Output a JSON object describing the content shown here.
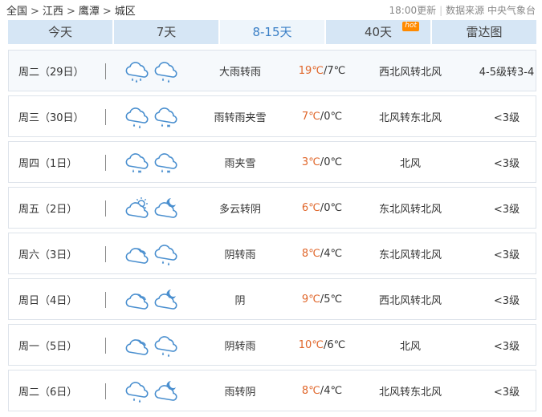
{
  "breadcrumb": [
    "全国",
    "江西",
    "鹰潭",
    "城区"
  ],
  "update_time": "18:00更新",
  "source": "数据来源 中央气象台",
  "tabs": [
    {
      "label": "今天",
      "active": false
    },
    {
      "label": "7天",
      "active": false
    },
    {
      "label": "8-15天",
      "active": true
    },
    {
      "label": "40天",
      "active": false,
      "badge": "hot"
    },
    {
      "label": "雷达图",
      "active": false
    }
  ],
  "colors": {
    "high_temp": "#e0662a",
    "active_tab_text": "#3a7fc6",
    "tab_bg": "#d6e6f5",
    "badge": "#ff8a00"
  },
  "days": [
    {
      "day": "周二（29日）",
      "icons": [
        "heavy-rain-icon",
        "rain-icon"
      ],
      "weather": "大雨转雨",
      "high": "19℃",
      "low": "7℃",
      "wind": "西北风转北风",
      "level": "4-5级转3-4"
    },
    {
      "day": "周三（30日）",
      "icons": [
        "rain-icon",
        "sleet-icon"
      ],
      "weather": "雨转雨夹雪",
      "high": "7℃",
      "low": "0℃",
      "wind": "北风转东北风",
      "level": "<3级"
    },
    {
      "day": "周四（1日）",
      "icons": [
        "sleet-icon",
        "sleet-icon"
      ],
      "weather": "雨夹雪",
      "high": "3℃",
      "low": "0℃",
      "wind": "北风",
      "level": "<3级"
    },
    {
      "day": "周五（2日）",
      "icons": [
        "partly-cloudy-day-icon",
        "partly-cloudy-night-icon"
      ],
      "weather": "多云转阴",
      "high": "6℃",
      "low": "0℃",
      "wind": "东北风转北风",
      "level": "<3级"
    },
    {
      "day": "周六（3日）",
      "icons": [
        "overcast-icon",
        "rain-icon"
      ],
      "weather": "阴转雨",
      "high": "8℃",
      "low": "4℃",
      "wind": "东北风转北风",
      "level": "<3级"
    },
    {
      "day": "周日（4日）",
      "icons": [
        "overcast-icon",
        "partly-cloudy-night-icon"
      ],
      "weather": "阴",
      "high": "9℃",
      "low": "5℃",
      "wind": "西北风转北风",
      "level": "<3级"
    },
    {
      "day": "周一（5日）",
      "icons": [
        "overcast-icon",
        "rain-icon"
      ],
      "weather": "阴转雨",
      "high": "10℃",
      "low": "6℃",
      "wind": "北风",
      "level": "<3级"
    },
    {
      "day": "周二（6日）",
      "icons": [
        "rain-icon",
        "partly-cloudy-night-icon"
      ],
      "weather": "雨转阴",
      "high": "8℃",
      "low": "4℃",
      "wind": "北风转东北风",
      "level": "<3级"
    }
  ]
}
